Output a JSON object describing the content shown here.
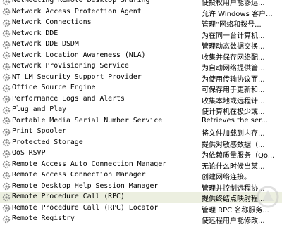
{
  "services": [
    {
      "name": "NetMeeting Remote Desktop Sharing",
      "description": "使授权用户能够远..."
    },
    {
      "name": "Network Access Protection Agent",
      "description": "允许 Windows 客户..."
    },
    {
      "name": "Network Connections",
      "description": "管理“网络和拨号..."
    },
    {
      "name": "Network DDE",
      "description": "为在同一台计算机..."
    },
    {
      "name": "Network DDE DSDM",
      "description": "管理动态数据交换..."
    },
    {
      "name": "Network Location Awareness (NLA)",
      "description": "收集并保存网络配..."
    },
    {
      "name": "Network Provisioning Service",
      "description": "为自动网络提供管..."
    },
    {
      "name": "NT LM Security Support Provider",
      "description": "为使用传输协议而..."
    },
    {
      "name": "Office Source Engine",
      "description": "可保存用于更新和..."
    },
    {
      "name": "Performance Logs and Alerts",
      "description": "收集本地或远程计..."
    },
    {
      "name": "Plug and Play",
      "description": "使计算机在极少或..."
    },
    {
      "name": "Portable Media Serial Number Service",
      "description": "Retrieves the ser..."
    },
    {
      "name": "Print Spooler",
      "description": "将文件加载到内存..."
    },
    {
      "name": "Protected Storage",
      "description": "提供对敏感数据（..."
    },
    {
      "name": "QoS RSVP",
      "description": "为依赖质量服务（Qo..."
    },
    {
      "name": "Remote Access Auto Connection Manager",
      "description": "无论什么时候当某..."
    },
    {
      "name": "Remote Access Connection Manager",
      "description": "创建网络连接。"
    },
    {
      "name": "Remote Desktop Help Session Manager",
      "description": "管理并控制远程协..."
    },
    {
      "name": "Remote Procedure Call (RPC)",
      "description": "提供终结点映射程..."
    },
    {
      "name": "Remote Procedure Call (RPC) Locator",
      "description": "管理 RPC 名称服务..."
    },
    {
      "name": "Remote Registry",
      "description": "使远程用户能修改..."
    }
  ],
  "selected_index": 18,
  "colors": {
    "icon_gear": "#8a8a8a",
    "selection": "#ecefe0"
  }
}
